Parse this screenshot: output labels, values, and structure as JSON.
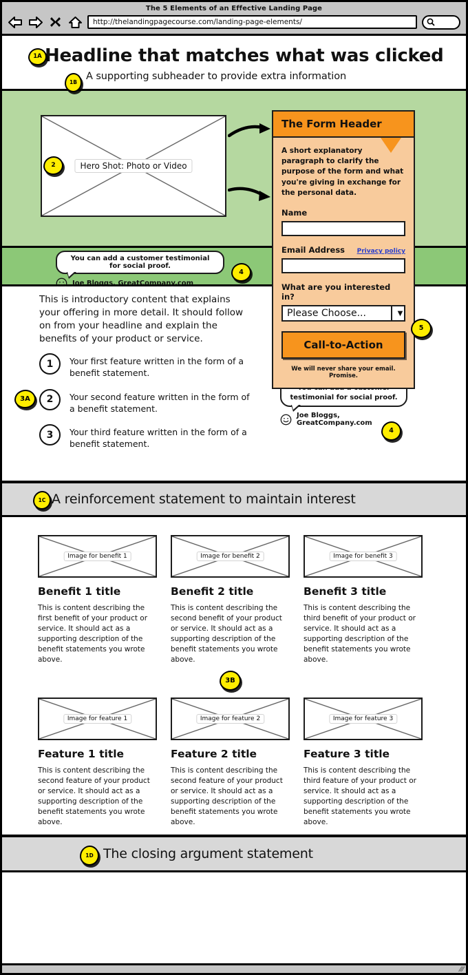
{
  "browser": {
    "title": "The 5 Elements of an Effective Landing Page",
    "url": "http://thelandingpagecourse.com/landing-page-elements/",
    "back_icon": "back-arrow-icon",
    "forward_icon": "forward-arrow-icon",
    "stop_icon": "stop-x-icon",
    "home_icon": "home-icon",
    "search_icon": "search-icon"
  },
  "header": {
    "badge_1a": "1A",
    "headline": "Headline that matches what was clicked",
    "badge_1b": "1B",
    "subheader": "A supporting subheader to provide extra information"
  },
  "hero": {
    "badge_2": "2",
    "image_label": "Hero Shot: Photo or Video"
  },
  "form": {
    "header": "The Form Header",
    "paragraph": "A short explanatory paragraph to clarify the purpose of the form and what you're giving in exchange for the personal data.",
    "name_label": "Name",
    "name_value": "",
    "email_label": "Email Address",
    "email_value": "",
    "privacy_link": "Privacy policy",
    "interest_label": "What are you interested in?",
    "select_value": "Please Choose...",
    "cta_label": "Call-to-Action",
    "promise": "We will never share your email. Promise.",
    "badge_5": "5"
  },
  "testimonial_top": {
    "quote": "You can add a customer testimonial for social proof.",
    "attribution": "Joe Bloggs, GreatCompany.com",
    "badge_4": "4"
  },
  "testimonial_side": {
    "quote": "You can add a customer testimonial for social proof.",
    "attribution": "Joe Bloggs, GreatCompany.com",
    "badge_4": "4"
  },
  "intro": {
    "paragraph": "This is introductory content that explains your offering in more detail. It should follow on from your headline and explain the benefits of your product or service.",
    "badge_3a": "3A",
    "features": [
      {
        "num": "1",
        "text": "Your first feature written in the form of a benefit statement."
      },
      {
        "num": "2",
        "text": "Your second feature written in the form of a benefit statement."
      },
      {
        "num": "3",
        "text": "Your third feature written in the form of a benefit statement."
      }
    ]
  },
  "reinforcement": {
    "badge_1c": "1C",
    "text": "A reinforcement statement to maintain interest"
  },
  "benefits": [
    {
      "image_label": "Image for benefit 1",
      "title": "Benefit 1 title",
      "body": "This is content describing the first benefit of your product or service. It should act as a supporting description of the benefit statements you wrote above."
    },
    {
      "image_label": "Image for benefit 2",
      "title": "Benefit 2 title",
      "body": "This is content describing the second benefit of your product or service. It should act as a supporting description of the benefit statements you wrote above."
    },
    {
      "image_label": "Image for benefit 3",
      "title": "Benefit 3 title",
      "body": "This is content describing the third benefit of your product or service. It should act as a supporting description of the benefit statements you wrote above."
    }
  ],
  "badge_3b": "3B",
  "features_grid": [
    {
      "image_label": "Image for feature 1",
      "title": "Feature 1 title",
      "body": "This is content describing the second feature of your product or service. It should act as a supporting description of the benefit statements you wrote above."
    },
    {
      "image_label": "Image for feature 2",
      "title": "Feature 2 title",
      "body": "This is content describing the second feature of your product or service. It should act as a supporting description of the benefit statements you wrote above."
    },
    {
      "image_label": "Image for feature 3",
      "title": "Feature 3 title",
      "body": "This is content describing the third feature of your product or service. It should act as a supporting description of the benefit statements you wrote above."
    }
  ],
  "closing": {
    "badge_1d": "1D",
    "text": "The closing argument statement"
  },
  "colors": {
    "hero_green": "#b5d8a0",
    "testimonial_green": "#8cc877",
    "form_peach": "#f8cb9c",
    "orange": "#f7941d",
    "badge_yellow": "#ffee00",
    "band_gray": "#d8d8d8",
    "chrome_gray": "#c6c6c6",
    "link_blue": "#2b3fcc"
  }
}
